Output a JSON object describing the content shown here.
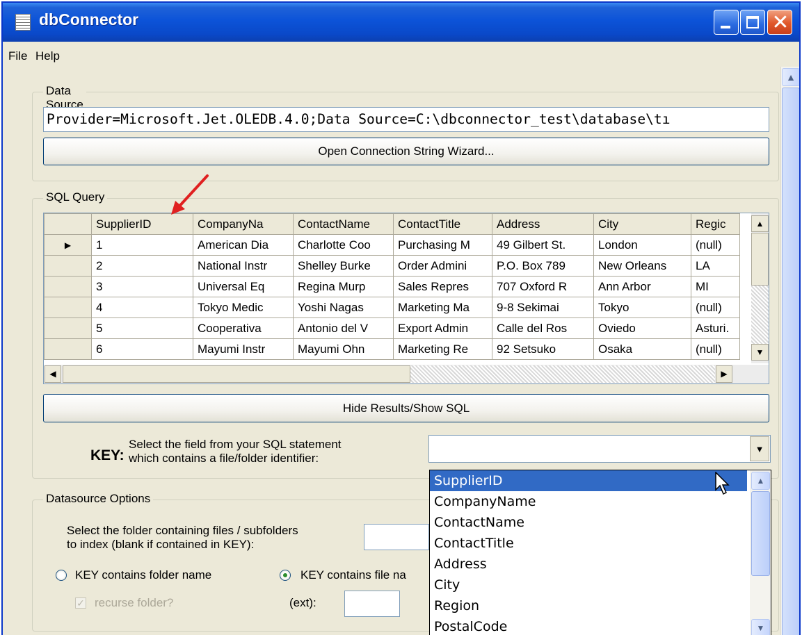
{
  "window": {
    "title": "dbConnector"
  },
  "menu": {
    "file": "File",
    "help": "Help"
  },
  "data_source": {
    "legend": "Data Source",
    "connection_string": "Provider=Microsoft.Jet.OLEDB.4.0;Data Source=C:\\dbconnector_test\\database\\tı",
    "wizard_button": "Open Connection String Wizard..."
  },
  "sql_query": {
    "legend": "SQL Query",
    "columns": [
      "SupplierID",
      "CompanyNa",
      "ContactName",
      "ContactTitle",
      "Address",
      "City",
      "Regic"
    ],
    "rows": [
      [
        "1",
        "American Dia",
        "Charlotte Coo",
        "Purchasing M",
        "49 Gilbert St.",
        "London",
        "(null)"
      ],
      [
        "2",
        "National Instr",
        "Shelley Burke",
        "Order Admini",
        "P.O. Box 789",
        "New Orleans",
        "LA"
      ],
      [
        "3",
        "Universal Eq",
        "Regina Murp",
        "Sales Repres",
        "707 Oxford R",
        "Ann Arbor",
        "MI"
      ],
      [
        "4",
        "Tokyo Medic",
        "Yoshi Nagas",
        "Marketing Ma",
        "9-8 Sekimai",
        "Tokyo",
        "(null)"
      ],
      [
        "5",
        "Cooperativa",
        "Antonio del V",
        "Export Admin",
        "Calle del Ros",
        "Oviedo",
        "Asturi."
      ],
      [
        "6",
        "Mayumi Instr",
        "Mayumi Ohn",
        "Marketing Re",
        "92 Setsuko",
        "Osaka",
        "(null)"
      ]
    ],
    "toggle_button": "Hide Results/Show SQL",
    "key_label": "KEY:",
    "key_desc_line1": "Select the field from your SQL statement",
    "key_desc_line2": "which contains a file/folder identifier:",
    "key_value": ""
  },
  "dropdown": {
    "options": [
      "SupplierID",
      "CompanyName",
      "ContactName",
      "ContactTitle",
      "Address",
      "City",
      "Region",
      "PostalCode"
    ],
    "selected": "SupplierID"
  },
  "datasource_options": {
    "legend": "Datasource Options",
    "folder_label_line1": "Select the folder containing files / subfolders",
    "folder_label_line2": "to index (blank if contained in KEY):",
    "folder_value": "",
    "radio_folder": "KEY contains folder name",
    "radio_file": "KEY contains file na",
    "radio_selected": "file",
    "recurse_label": "recurse folder?",
    "recurse_checked": true,
    "ext_label": "(ext):",
    "ext_value": ""
  },
  "colors": {
    "title_bar": "#0a49c9",
    "selection": "#316ac5",
    "arrow": "#e02020"
  }
}
